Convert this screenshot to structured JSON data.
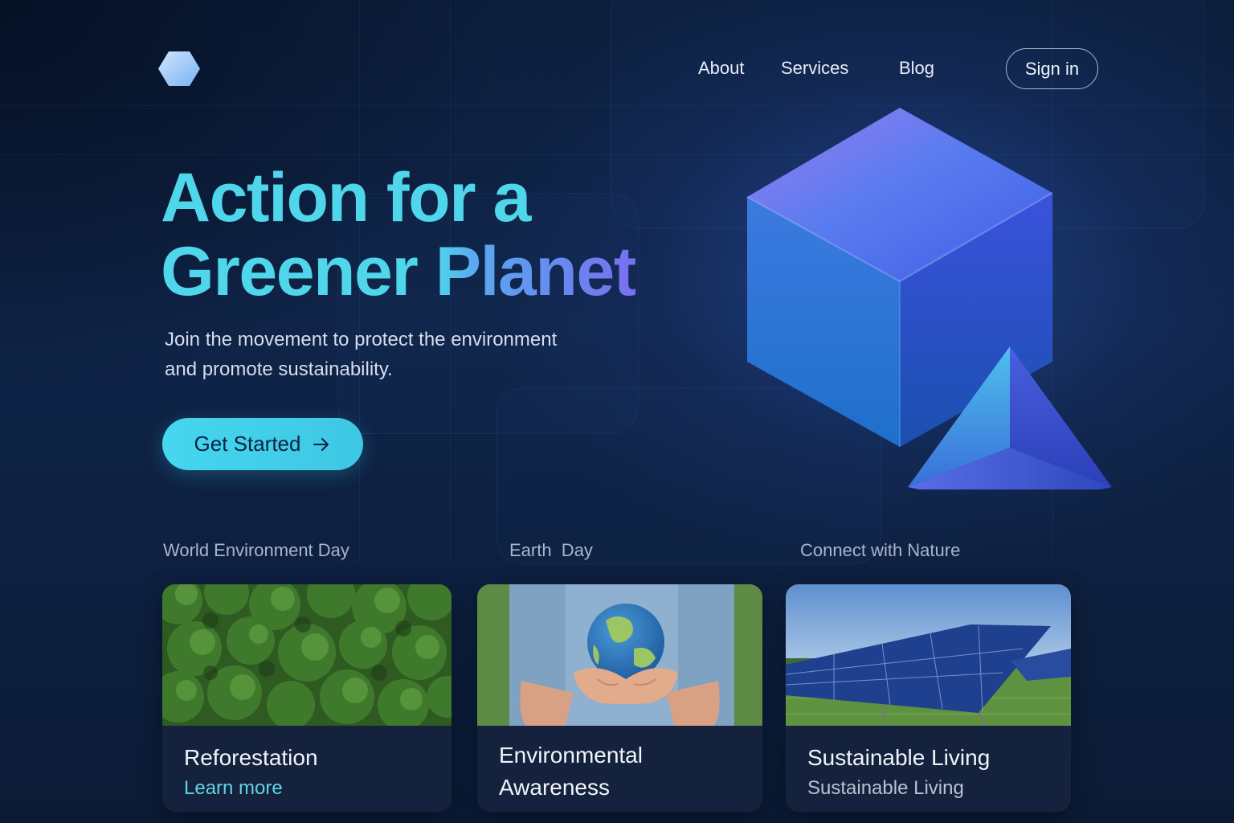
{
  "header": {
    "logo_icon": "hexagon-logo-icon",
    "nav": [
      {
        "label": "About"
      },
      {
        "label": "Services"
      },
      {
        "label": "Blog"
      }
    ],
    "signin_label": "Sign in"
  },
  "hero": {
    "title_line1": "Action for a",
    "title_line2_part1": "Greener",
    "title_line2_part2": "Planet",
    "subtitle_line1": "Join the movement to protect the environment",
    "subtitle_line2": "and promote sustainability.",
    "cta_label": "Get Started",
    "cta_icon": "arrow-right-icon",
    "illustration": "cube-and-pyramid-3d-shapes"
  },
  "categories": [
    {
      "label": "World Environment Day"
    },
    {
      "label": "Earth  Day"
    },
    {
      "label": "Connect with Nature"
    }
  ],
  "cards": [
    {
      "title": "Reforestation",
      "subtitle": "Learn more",
      "image": "forest-canopy-image",
      "subtitle_color": "#5fd4e6"
    },
    {
      "title_line1": "Environmental",
      "title_line2": "Awareness",
      "image": "hands-holding-earth-image"
    },
    {
      "title": "Sustainable Living",
      "subtitle": "Sustainable Living",
      "image": "solar-panels-image",
      "subtitle_color": "#b9c2d3"
    }
  ],
  "colors": {
    "accent_cyan": "#46d6ee",
    "accent_violet": "#6a84ee",
    "background": "#0f2448"
  }
}
